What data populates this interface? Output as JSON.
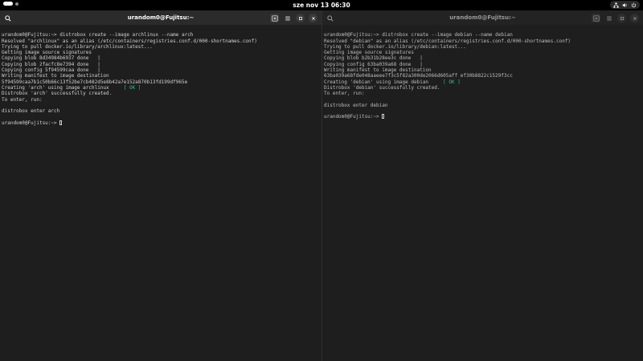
{
  "topbar": {
    "clock": "sze nov 13  06:30"
  },
  "colors": {
    "ok": "#2ec27e",
    "background": "#1e1e1e",
    "header_active": "#2b2b2b"
  },
  "windows": [
    {
      "title": "urandom0@Fujitsu:~",
      "icons": [
        "search-icon",
        "new-tab-icon",
        "menu-icon",
        "maximize-icon",
        "close-icon"
      ],
      "lines": [
        "urandom0@Fujitsu:~> distrobox create --image archlinux --name arch",
        "Resolved \"archlinux\" as an alias (/etc/containers/registries.conf.d/000-shortnames.conf)",
        "Trying to pull docker.io/library/archlinux:latest...",
        "Getting image source signatures",
        "Copying blob 8d34984b6937 done   |",
        "Copying blob 2facfc8e7394 done   |",
        "Copying config 5f94599caa done   |",
        "Writing manifest to image destination",
        "5f94599caa7b1c50b66c13f52be7cb482d5e8b42a7e152a870b13fd199df965e",
        "Creating 'arch' using image archlinux     ",
        "Distrobox 'arch' successfully created.",
        "To enter, run:",
        "",
        "distrobox enter arch",
        "",
        "urandom0@Fujitsu:~> "
      ],
      "ok_label": "[ OK ]"
    },
    {
      "title": "urandom0@Fujitsu:~",
      "icons": [
        "search-icon",
        "new-tab-icon",
        "menu-icon",
        "maximize-icon",
        "close-icon"
      ],
      "lines": [
        "urandom0@Fujitsu:~> distrobox create --image debian --name debian",
        "Resolved \"debian\" as an alias (/etc/containers/registries.conf.d/000-shortnames.conf)",
        "Trying to pull docker.io/library/debian:latest...",
        "Getting image source signatures",
        "Copying blob b2b31b28ee3c done   |",
        "Copying config 63ba039a68 done   |",
        "Writing manifest to image destination",
        "63ba039a68fde048aaeee7f3c5f82a300de2066d605aff ef30b8822c1529f3cc",
        "Creating 'debian' using image debian     ",
        "Distrobox 'debian' successfully created.",
        "To enter, run:",
        "",
        "distrobox enter debian",
        "",
        "urandom0@Fujitsu:~> "
      ],
      "ok_label": "[ OK ]"
    }
  ]
}
